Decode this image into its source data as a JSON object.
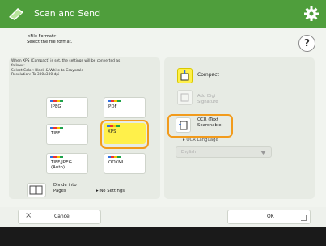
{
  "header": {
    "title": "Scan and Send",
    "app_icon": "scanner-icon",
    "settings_icon": "gear-icon"
  },
  "instructions": {
    "line1": "<File Format>",
    "line2": "Select the file format.",
    "help_label": "?"
  },
  "info": {
    "line1": "When XPS (Compact) is set, the settings will be converted as",
    "line2": "follows:",
    "line3": "Select Color: Black & White to Grayscale",
    "line4": "Resolution: To 300x300 dpi"
  },
  "formats": {
    "jpeg": "JPEG",
    "pdf": "PDF",
    "tiff": "TIFF",
    "xps": "XPS",
    "tiff_jpeg_1": "TIFF/JPEG",
    "tiff_jpeg_2": "(Auto)",
    "ooxml": "OOXML",
    "selected": "XPS"
  },
  "divide": {
    "label_1": "Divide into",
    "label_2": "Pages",
    "status": "No Settings"
  },
  "options": {
    "compact": "Compact",
    "signature_1": "Add Digi",
    "signature_2": "Signature",
    "ocr_1": "OCR (Text",
    "ocr_2": "Searchable)",
    "ocr_language_label": "OCR Language",
    "ocr_language_value": "English"
  },
  "footer": {
    "cancel": "Cancel",
    "ok": "OK"
  },
  "colors": {
    "header": "#4f9e3c",
    "selected": "#fff04a",
    "highlight": "#f29b1c"
  }
}
